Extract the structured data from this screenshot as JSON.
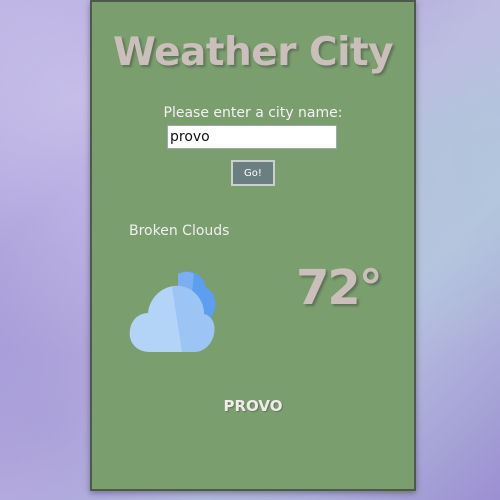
{
  "app": {
    "title": "Weather City",
    "background_color": "#7a9e6e"
  },
  "search": {
    "prompt": "Please enter a city name:",
    "value": "provo",
    "button_label": "Go!"
  },
  "weather": {
    "condition": "Broken Clouds",
    "icon": "cloud-icon",
    "temperature": "72°",
    "city": "PROVO"
  }
}
